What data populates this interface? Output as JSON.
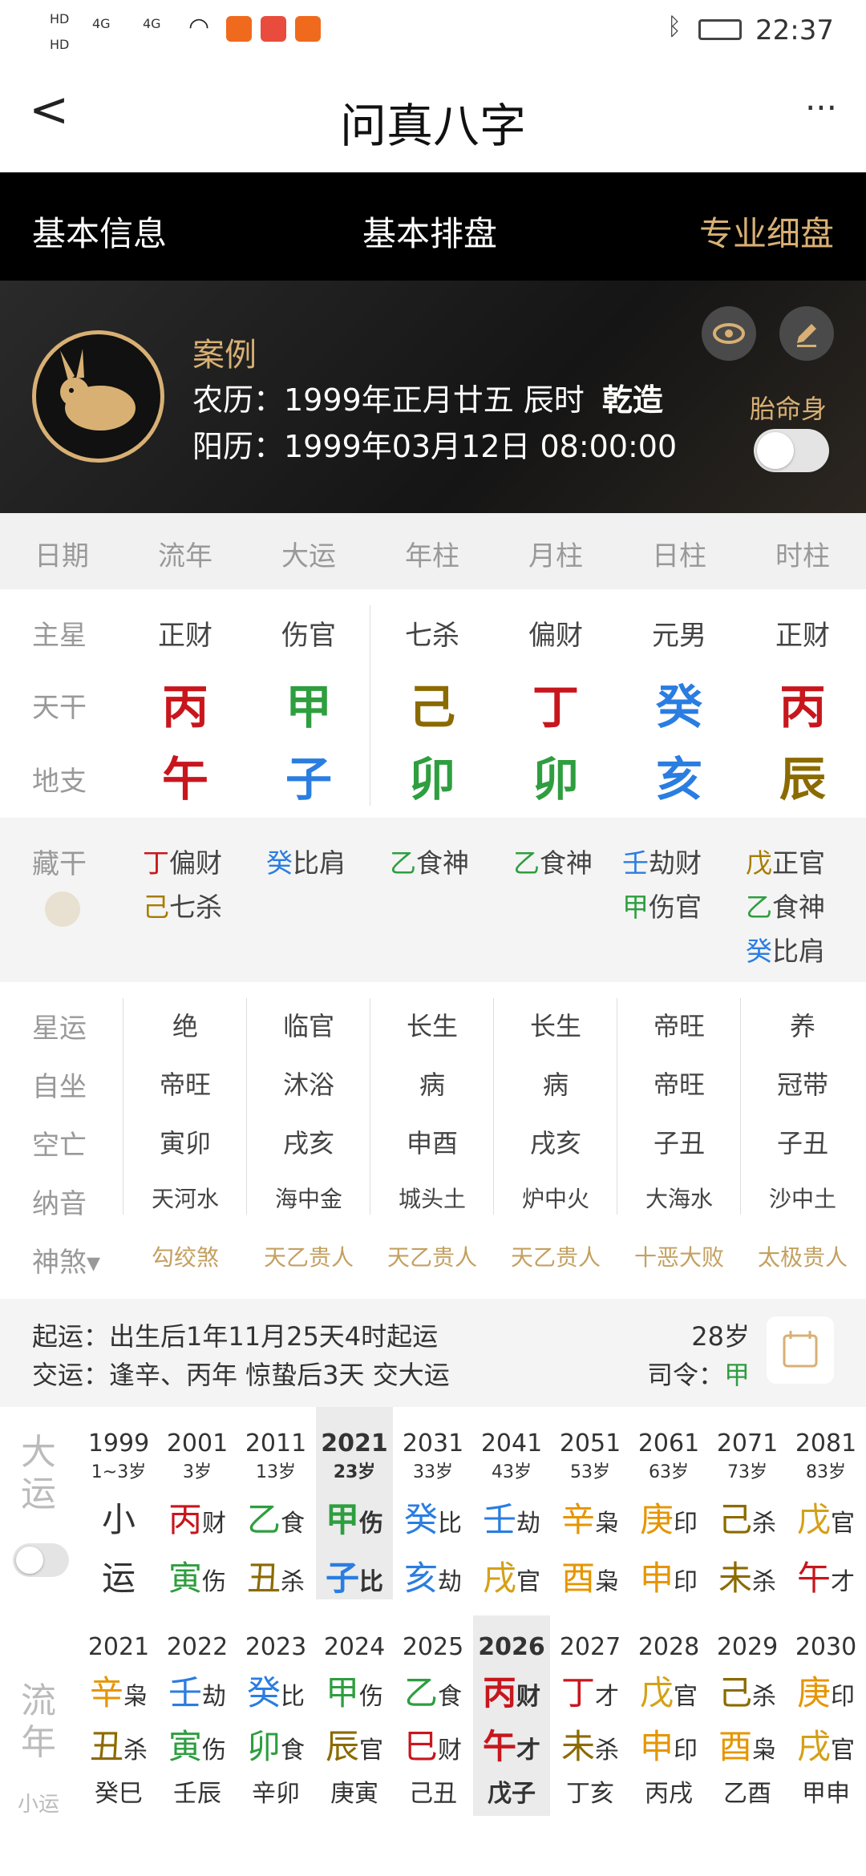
{
  "status": {
    "time": "22:37",
    "hd1": "HD",
    "hd2": "HD",
    "net1": "4G",
    "net2": "4G"
  },
  "appbar": {
    "title": "问真八字",
    "more": "···",
    "back": "<"
  },
  "tabs": [
    "基本信息",
    "基本排盘",
    "专业细盘"
  ],
  "header": {
    "case_label": "案例",
    "lunar": "农历：1999年正月廿五 辰时",
    "gender": "乾造",
    "solar": "阳历：1999年03月12日 08:00:00",
    "taiming": "胎命身"
  },
  "cols": [
    "日期",
    "流年",
    "大运",
    "年柱",
    "月柱",
    "日柱",
    "时柱"
  ],
  "rows": {
    "zhuxing": "主星",
    "tiangan": "天干",
    "dizhi": "地支",
    "canggan": "藏干",
    "xingyun": "星运",
    "zizuo": "自坐",
    "kongwang": "空亡",
    "nayin": "纳音",
    "shensha": "神煞▾"
  },
  "pillars": [
    {
      "star": "正财",
      "tg": "丙",
      "tg_color": "#c8161d",
      "dz": "午",
      "dz_color": "#c8161d",
      "cg": [
        [
          "丁",
          "偏财",
          "#c8161d"
        ],
        [
          "己",
          "七杀",
          "#a67c00"
        ]
      ],
      "xy": "绝",
      "zz": "帝旺",
      "kw": "寅卯",
      "ny": "天河水",
      "ss": "勾绞煞"
    },
    {
      "star": "伤官",
      "tg": "甲",
      "tg_color": "#2e9e3f",
      "dz": "子",
      "dz_color": "#2a7de1",
      "cg": [
        [
          "癸",
          "比肩",
          "#2a7de1"
        ]
      ],
      "xy": "临官",
      "zz": "沐浴",
      "kw": "戌亥",
      "ny": "海中金",
      "ss": "天乙贵人"
    },
    {
      "star": "七杀",
      "tg": "己",
      "tg_color": "#8b6b00",
      "dz": "卯",
      "dz_color": "#2e9e3f",
      "cg": [
        [
          "乙",
          "食神",
          "#2e9e3f"
        ]
      ],
      "xy": "长生",
      "zz": "病",
      "kw": "申酉",
      "ny": "城头土",
      "ss": "天乙贵人"
    },
    {
      "star": "偏财",
      "tg": "丁",
      "tg_color": "#c8161d",
      "dz": "卯",
      "dz_color": "#2e9e3f",
      "cg": [
        [
          "乙",
          "食神",
          "#2e9e3f"
        ]
      ],
      "xy": "长生",
      "zz": "病",
      "kw": "戌亥",
      "ny": "炉中火",
      "ss": "天乙贵人"
    },
    {
      "star": "元男",
      "tg": "癸",
      "tg_color": "#2a7de1",
      "dz": "亥",
      "dz_color": "#2a7de1",
      "cg": [
        [
          "壬",
          "劫财",
          "#2a7de1"
        ],
        [
          "甲",
          "伤官",
          "#2e9e3f"
        ]
      ],
      "xy": "帝旺",
      "zz": "帝旺",
      "kw": "子丑",
      "ny": "大海水",
      "ss": "十恶大败"
    },
    {
      "star": "正财",
      "tg": "丙",
      "tg_color": "#c8161d",
      "dz": "辰",
      "dz_color": "#8b6b00",
      "cg": [
        [
          "戊",
          "正官",
          "#a67c00"
        ],
        [
          "乙",
          "食神",
          "#2e9e3f"
        ],
        [
          "癸",
          "比肩",
          "#2a7de1"
        ]
      ],
      "xy": "养",
      "zz": "冠带",
      "kw": "子丑",
      "ny": "沙中土",
      "ss": "太极贵人"
    }
  ],
  "qiyun": {
    "line1": "起运：出生后1年11月25天4时起运",
    "line2": "交运：逢辛、丙年 惊蛰后3天 交大运",
    "age": "28岁",
    "siling": "司令：",
    "siling_val": "甲"
  },
  "dayun": {
    "label1": "大",
    "label2": "运",
    "cols": [
      {
        "yr": "1999",
        "age": "1~3岁",
        "a": "小",
        "as": "",
        "ac": "#333",
        "b": "运",
        "bs": "",
        "bc": "#333"
      },
      {
        "yr": "2001",
        "age": "3岁",
        "a": "丙",
        "as": "财",
        "ac": "#c8161d",
        "b": "寅",
        "bs": "伤",
        "bc": "#2e9e3f"
      },
      {
        "yr": "2011",
        "age": "13岁",
        "a": "乙",
        "as": "食",
        "ac": "#2e9e3f",
        "b": "丑",
        "bs": "杀",
        "bc": "#8b6b00"
      },
      {
        "yr": "2021",
        "age": "23岁",
        "a": "甲",
        "as": "伤",
        "ac": "#2e9e3f",
        "b": "子",
        "bs": "比",
        "bc": "#2a7de1"
      },
      {
        "yr": "2031",
        "age": "33岁",
        "a": "癸",
        "as": "比",
        "ac": "#2a7de1",
        "b": "亥",
        "bs": "劫",
        "bc": "#2a7de1"
      },
      {
        "yr": "2041",
        "age": "43岁",
        "a": "壬",
        "as": "劫",
        "ac": "#2a7de1",
        "b": "戌",
        "bs": "官",
        "bc": "#d4a017"
      },
      {
        "yr": "2051",
        "age": "53岁",
        "a": "辛",
        "as": "枭",
        "ac": "#e69500",
        "b": "酉",
        "bs": "枭",
        "bc": "#e69500"
      },
      {
        "yr": "2061",
        "age": "63岁",
        "a": "庚",
        "as": "印",
        "ac": "#e69500",
        "b": "申",
        "bs": "印",
        "bc": "#e69500"
      },
      {
        "yr": "2071",
        "age": "73岁",
        "a": "己",
        "as": "杀",
        "ac": "#8b6b00",
        "b": "未",
        "bs": "杀",
        "bc": "#8b6b00"
      },
      {
        "yr": "2081",
        "age": "83岁",
        "a": "戊",
        "as": "官",
        "ac": "#d4a017",
        "b": "午",
        "bs": "才",
        "bc": "#c8161d"
      }
    ]
  },
  "liunian": {
    "label1": "流",
    "label2": "年",
    "label3": "小运",
    "cols": [
      {
        "yr": "2021",
        "a": "辛",
        "as": "枭",
        "ac": "#e69500",
        "b": "丑",
        "bs": "杀",
        "bc": "#8b6b00",
        "c": "癸巳"
      },
      {
        "yr": "2022",
        "a": "壬",
        "as": "劫",
        "ac": "#2a7de1",
        "b": "寅",
        "bs": "伤",
        "bc": "#2e9e3f",
        "c": "壬辰"
      },
      {
        "yr": "2023",
        "a": "癸",
        "as": "比",
        "ac": "#2a7de1",
        "b": "卯",
        "bs": "食",
        "bc": "#2e9e3f",
        "c": "辛卯"
      },
      {
        "yr": "2024",
        "a": "甲",
        "as": "伤",
        "ac": "#2e9e3f",
        "b": "辰",
        "bs": "官",
        "bc": "#8b6b00",
        "c": "庚寅"
      },
      {
        "yr": "2025",
        "a": "乙",
        "as": "食",
        "ac": "#2e9e3f",
        "b": "巳",
        "bs": "财",
        "bc": "#c8161d",
        "c": "己丑"
      },
      {
        "yr": "2026",
        "a": "丙",
        "as": "财",
        "ac": "#c8161d",
        "b": "午",
        "bs": "才",
        "bc": "#c8161d",
        "c": "戊子"
      },
      {
        "yr": "2027",
        "a": "丁",
        "as": "才",
        "ac": "#c8161d",
        "b": "未",
        "bs": "杀",
        "bc": "#8b6b00",
        "c": "丁亥"
      },
      {
        "yr": "2028",
        "a": "戊",
        "as": "官",
        "ac": "#d4a017",
        "b": "申",
        "bs": "印",
        "bc": "#e69500",
        "c": "丙戌"
      },
      {
        "yr": "2029",
        "a": "己",
        "as": "杀",
        "ac": "#8b6b00",
        "b": "酉",
        "bs": "枭",
        "bc": "#e69500",
        "c": "乙酉"
      },
      {
        "yr": "2030",
        "a": "庚",
        "as": "印",
        "ac": "#e69500",
        "b": "戌",
        "bs": "官",
        "bc": "#d4a017",
        "c": "甲申"
      }
    ]
  }
}
